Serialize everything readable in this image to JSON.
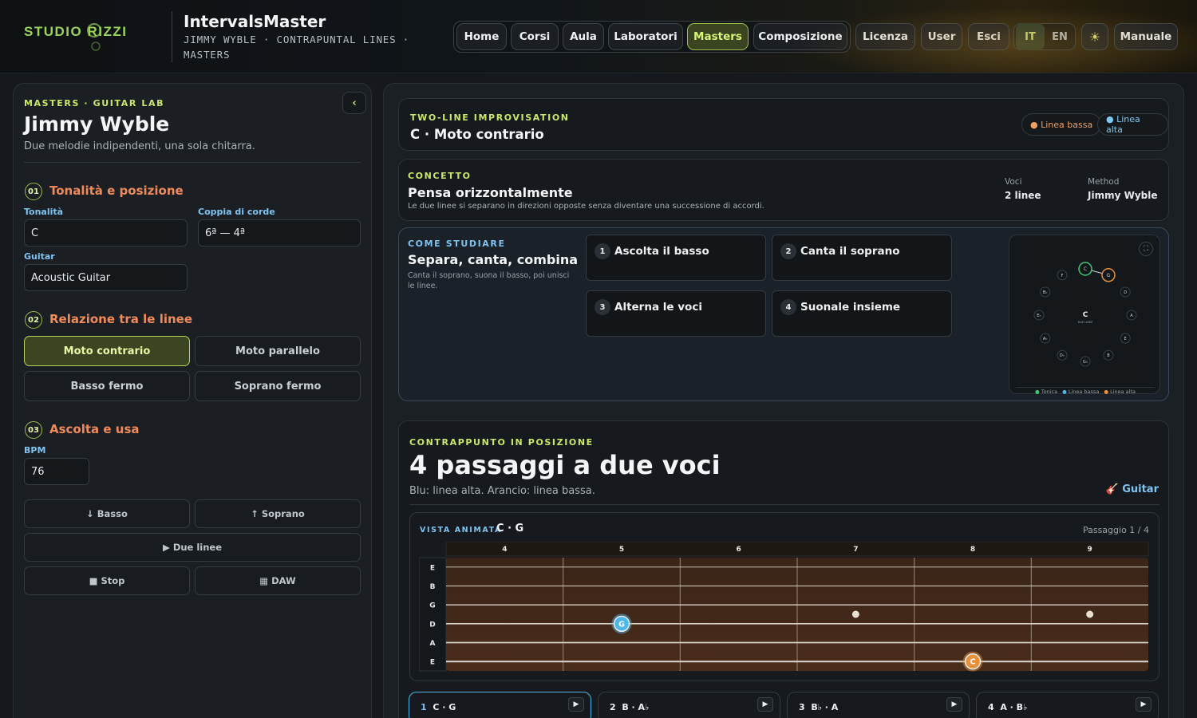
{
  "header": {
    "logo_text": "STUDIO RIZZI",
    "app_title": "IntervalsMaster",
    "subtitle": "JIMMY WYBLE · CONTRAPUNTAL LINES · MASTERS",
    "nav": [
      "Home",
      "Corsi",
      "Aula",
      "Laboratori",
      "Masters",
      "Composizione"
    ],
    "active_nav": "Masters",
    "secondary_nav": [
      "Licenza",
      "User",
      "Esci"
    ],
    "languages": [
      "IT",
      "EN"
    ],
    "active_language": "IT",
    "theme_icon": "sun-icon",
    "manual_label": "Manuale"
  },
  "left": {
    "eyebrow": "MASTERS · GUITAR LAB",
    "collapse_icon": "‹",
    "title": "Jimmy Wyble",
    "subtitle": "Due melodie indipendenti, una sola chitarra.",
    "section1": {
      "num": "01",
      "title": "Tonalità e posizione",
      "key_label": "Tonalità",
      "key_value": "C",
      "strings_label": "Coppia di corde",
      "strings_value": "6ª — 4ª",
      "guitar_label": "Guitar",
      "guitar_value": "Acoustic Guitar"
    },
    "section2": {
      "num": "02",
      "title": "Relazione tra le linee",
      "options": [
        "Moto contrario",
        "Moto parallelo",
        "Basso fermo",
        "Soprano fermo"
      ],
      "active": "Moto contrario"
    },
    "section3": {
      "num": "03",
      "title": "Ascolta e usa",
      "bpm_label": "BPM",
      "bpm_value": "76",
      "bass_btn": "↓ Basso",
      "soprano_btn": "↑ Soprano",
      "both_btn": "▶ Due linee",
      "stop_btn": "■ Stop",
      "daw_btn": "▦ DAW"
    }
  },
  "main": {
    "top_card": {
      "eyebrow": "TWO-LINE IMPROVISATION",
      "title": "C · Moto contrario",
      "legend_low": "● Linea bassa",
      "legend_high": "● Linea alta"
    },
    "concept": {
      "eyebrow": "CONCETTO",
      "title": "Pensa orizzontalmente",
      "text": "Le due linee si separano in direzioni opposte senza diventare una successione di accordi.",
      "voices_label": "Voci",
      "voices_value": "2 linee",
      "method_label": "Method",
      "method_value": "Jimmy Wyble"
    },
    "study": {
      "eyebrow": "COME STUDIARE",
      "title": "Separa, canta, combina",
      "text": "Canta il soprano, suona il basso, poi unisci le linee.",
      "steps": [
        {
          "num": "1",
          "label": "Ascolta il basso"
        },
        {
          "num": "2",
          "label": "Canta il soprano"
        },
        {
          "num": "3",
          "label": "Alterna le voci"
        },
        {
          "num": "4",
          "label": "Suonale insieme"
        }
      ],
      "circle": {
        "center": "C",
        "center_sub": "DUE LINEE",
        "notes": [
          "C",
          "G",
          "D",
          "A",
          "E",
          "B",
          "G♭",
          "D♭",
          "A♭",
          "E♭",
          "B♭",
          "F"
        ],
        "tonic": "C",
        "high": "G",
        "legend": [
          "Tonica",
          "Linea bassa",
          "Linea alta"
        ]
      }
    },
    "counterpoint": {
      "eyebrow": "CONTRAPPUNTO IN POSIZIONE",
      "title": "4 passaggi a due voci",
      "text": "Blu: linea alta. Arancio: linea bassa.",
      "instrument": "🎸 Guitar",
      "view_label": "VISTA ANIMATA",
      "current": "C · G",
      "passage_counter": "Passaggio 1 / 4",
      "fret_numbers": [
        "4",
        "5",
        "6",
        "7",
        "8",
        "9"
      ],
      "strings": [
        "E",
        "B",
        "G",
        "D",
        "A",
        "E"
      ],
      "notes": [
        {
          "label": "G",
          "string": 4,
          "fret": 5,
          "line": "alta"
        },
        {
          "label": "C",
          "string": 6,
          "fret": 8,
          "line": "bassa"
        }
      ],
      "passages": [
        {
          "num": "1",
          "label": "C · G"
        },
        {
          "num": "2",
          "label": "B · A♭"
        },
        {
          "num": "3",
          "label": "B♭ · A"
        },
        {
          "num": "4",
          "label": "A · B♭"
        }
      ],
      "play_icon": "▶"
    }
  },
  "colors": {
    "accent": "#c9e86a",
    "orange": "#f08a5a",
    "blue": "#4fb6e8",
    "low_line": "#e8903a",
    "high_line": "#4fb6e8",
    "tonic": "#3fc97a"
  }
}
